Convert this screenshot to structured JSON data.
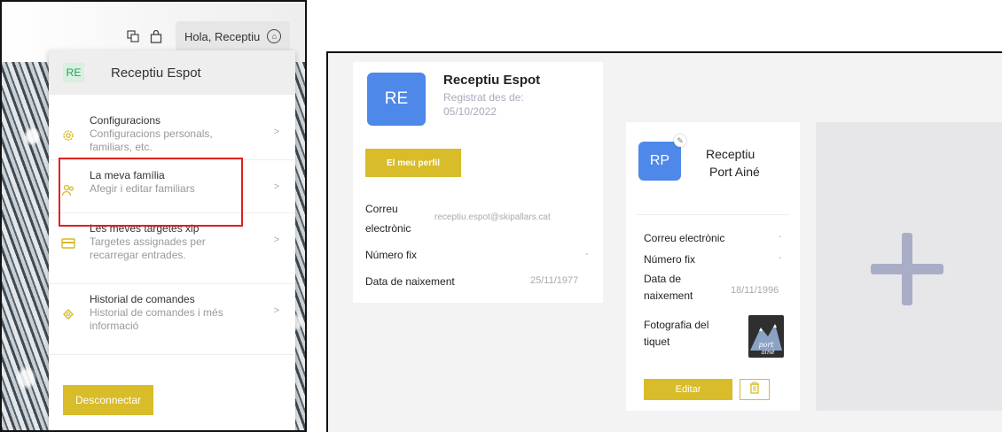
{
  "header": {
    "greeting": "Hola, Receptiu",
    "icons": [
      "translate-icon",
      "bag-icon",
      "account-icon"
    ]
  },
  "menu": {
    "badge": "RE",
    "user_name": "Receptiu Espot",
    "items": [
      {
        "title": "Configuracions",
        "subtitle_line1": "Configuracions personals,",
        "subtitle_line2": "familiars, etc.",
        "icon": "gear-icon"
      },
      {
        "title": "La meva família",
        "subtitle_line1": "Afegir i editar familiars",
        "subtitle_line2": "",
        "icon": "family-icon"
      },
      {
        "title": "Les meves targetes xip",
        "subtitle_line1": "Targetes assignades per",
        "subtitle_line2": "recarregar entrades.",
        "icon": "card-icon"
      },
      {
        "title": "Historial de comandes",
        "subtitle_line1": "Historial de comandes i més",
        "subtitle_line2": "informació",
        "icon": "ticket-icon"
      }
    ],
    "logout_label": "Desconnectar"
  },
  "profile": {
    "initials": "RE",
    "name": "Receptiu Espot",
    "registered_line1": "Registrat des de:",
    "registered_line2": "05/10/2022",
    "profile_button": "El meu perfil",
    "email_label_line1": "Correu",
    "email_label_line2": "electrònic",
    "email_value": "receptiu.espot@skipallars.cat",
    "phone_label": "Número fix",
    "phone_value": "-",
    "birth_label": "Data de naixement",
    "birth_value": "25/11/1977"
  },
  "family_member": {
    "initials": "RP",
    "name_line1": "Receptiu",
    "name_line2": "Port Ainé",
    "email_label": "Correu electrònic",
    "email_value": "-",
    "phone_label": "Número fix",
    "phone_value": "-",
    "birth_label_line1": "Data de",
    "birth_label_line2": "naixement",
    "birth_value": "18/11/1996",
    "photo_label_line1": "Fotografia del",
    "photo_label_line2": "tiquet",
    "photo_text_line1": "port",
    "photo_text_line2": "ainé",
    "edit_label": "Editar"
  },
  "colors": {
    "accent_yellow": "#d8bc2a",
    "avatar_blue": "#4e88e8",
    "highlight_red": "#e02020"
  }
}
